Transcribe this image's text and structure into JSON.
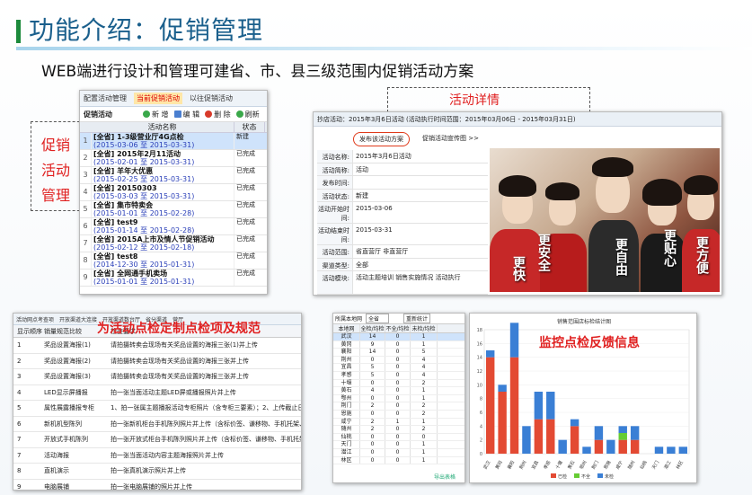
{
  "header": {
    "title": "功能介绍：促销管理",
    "subtitle": "WEB端进行设计和管理可建省、市、县三级范围内促销活动方案"
  },
  "labels": {
    "left": "促销活动管理",
    "detail": "活动详情",
    "checkpoint": "为活动点检定制点检项及规范",
    "feedback": "监控点检反馈信息"
  },
  "promo": {
    "tabs": [
      "配置活动管理",
      "当前促销活动",
      "以往促销活动"
    ],
    "toolbar": {
      "title": "促销活动",
      "new": "新 增",
      "edit": "编 辑",
      "delete": "删 除",
      "refresh": "刷新"
    },
    "columns": {
      "name": "活动名称",
      "status": "状态"
    },
    "rows": [
      {
        "n": "1",
        "name": "[全省] 1-3级营业厅4G点检",
        "date": "(2015-03-06 至 2015-03-31)",
        "status": "新建"
      },
      {
        "n": "2",
        "name": "[全省] 2015年2月11活动",
        "date": "(2015-02-01 至 2015-03-31)",
        "status": "已完成"
      },
      {
        "n": "3",
        "name": "[全省] 羊年大优惠",
        "date": "(2015-02-25 至 2015-03-31)",
        "status": "已完成"
      },
      {
        "n": "4",
        "name": "[全省] 20150303",
        "date": "(2015-03-03 至 2015-03-31)",
        "status": "已完成"
      },
      {
        "n": "5",
        "name": "[全省] 集市特卖会",
        "date": "(2015-01-01 至 2015-02-28)",
        "status": "已完成"
      },
      {
        "n": "6",
        "name": "[全省] test9",
        "date": "(2015-01-14 至 2015-02-28)",
        "status": "已完成"
      },
      {
        "n": "7",
        "name": "[全省] 2015A上市及情人节促销活动",
        "date": "(2015-02-12 至 2015-02-18)",
        "status": "已完成"
      },
      {
        "n": "8",
        "name": "[全省] test8",
        "date": "(2014-12-30 至 2015-01-31)",
        "status": "已完成"
      },
      {
        "n": "9",
        "name": "[全省] 全网通手机卖场",
        "date": "(2015-01-01 至 2015-01-31)",
        "status": "已完成"
      }
    ]
  },
  "detail": {
    "head": "抄店活动：2015年3月6日活动 (活动执行时间范围：2015年03月06日 - 2015年03月31日)",
    "btn_publish": "发布该活动方案",
    "btn_img": "促销活动宣传图 >>",
    "fields": [
      {
        "k": "活动名称:",
        "v": "2015年3月6日活动"
      },
      {
        "k": "活动简称:",
        "v": "活动"
      },
      {
        "k": "发布时间:",
        "v": ""
      },
      {
        "k": "活动状态:",
        "v": "新建"
      },
      {
        "k": "活动开始时间:",
        "v": "2015-03-06"
      },
      {
        "k": "活动结束时间:",
        "v": "2015-03-31"
      },
      {
        "k": "活动范围:",
        "v": "省直营厅 非直营厅"
      },
      {
        "k": "渠道类型:",
        "v": "全部"
      },
      {
        "k": "活动模块:",
        "v": "活动主题培训 销售实施情况 活动执行"
      },
      {
        "k": "活动描述:",
        "v": ""
      }
    ],
    "slogans": [
      "更安全",
      "更快",
      "更自由",
      "更贴心",
      "更方便"
    ]
  },
  "checklist": {
    "tabs": [
      "活动网点考查项",
      "开放渠道大连接",
      "开放渠道数台厅",
      "省分渠道",
      "营厅"
    ],
    "columns": {
      "seq": "显示顺序",
      "item": "销量规范比较",
      "req": "检查要求"
    },
    "rows": [
      {
        "seq": "1",
        "item": "奖品设置海报(1)",
        "req": "请拍摄转卖会现场有关奖品设置的海报三张(1)并上传"
      },
      {
        "seq": "2",
        "item": "奖品设置海报(2)",
        "req": "请拍摄转卖会现场有关奖品设置的海报三张并上传"
      },
      {
        "seq": "3",
        "item": "奖品设置海报(3)",
        "req": "请拍摄转卖会现场有关奖品设置的海报三张并上传"
      },
      {
        "seq": "4",
        "item": "LED显示屏播报",
        "req": "拍一张当面活动主题LED屏或播报照片并上传"
      },
      {
        "seq": "5",
        "item": "属性展露播报专柜",
        "req": "1、拍一张属主题播报活动专柜照片（含专柜三要素）；2、上传截止日期为3月30日24点"
      },
      {
        "seq": "6",
        "item": "新机机型陈列",
        "req": "拍一张新机柜台手机陈列照片并上传（含标价签、谦移物、手机托架、绑卡挂件）"
      },
      {
        "seq": "7",
        "item": "开放式手机陈列",
        "req": "拍一张开放式柜台手机陈列照片并上传（含标价签、谦移物、手机托架、功能台卡、宣传单页）"
      },
      {
        "seq": "7",
        "item": "活动海报",
        "req": "拍一张当面活动内容主题海报照片并上传"
      },
      {
        "seq": "8",
        "item": "直机演示",
        "req": "拍一张真机演示照片并上传"
      },
      {
        "seq": "9",
        "item": "电脑展铺",
        "req": "拍一张电脑展铺的照片并上传"
      },
      {
        "seq": "10",
        "item": "礼品堆头",
        "req": "拍一张礼品堆头的照片并上传"
      }
    ]
  },
  "region": {
    "select": "全省",
    "btn": "重新统计",
    "top": "所属本地网",
    "columns": [
      "本地网",
      "全检/均检",
      "不全/均检",
      "未检/均检"
    ],
    "rows": [
      [
        "武汉",
        "14",
        "0",
        "1"
      ],
      [
        "黄冈",
        "9",
        "0",
        "1"
      ],
      [
        "襄阳",
        "14",
        "0",
        "5"
      ],
      [
        "荆州",
        "0",
        "0",
        "4"
      ],
      [
        "宜昌",
        "5",
        "0",
        "4"
      ],
      [
        "孝感",
        "5",
        "0",
        "4"
      ],
      [
        "十堰",
        "0",
        "0",
        "2"
      ],
      [
        "黄石",
        "4",
        "0",
        "1"
      ],
      [
        "鄂州",
        "0",
        "0",
        "1"
      ],
      [
        "荆门",
        "2",
        "0",
        "2"
      ],
      [
        "恩施",
        "0",
        "0",
        "2"
      ],
      [
        "咸宁",
        "2",
        "1",
        "1"
      ],
      [
        "随州",
        "2",
        "0",
        "2"
      ],
      [
        "仙桃",
        "0",
        "0",
        "0"
      ],
      [
        "天门",
        "0",
        "0",
        "1"
      ],
      [
        "潜江",
        "0",
        "0",
        "1"
      ],
      [
        "林区",
        "0",
        "0",
        "1"
      ]
    ],
    "foot": "导出表格"
  },
  "chart_data": {
    "type": "bar",
    "title": "销售范围店标检结计图",
    "categories": [
      "武汉",
      "黄冈",
      "襄阳",
      "荆州",
      "宜昌",
      "孝感",
      "十堰",
      "黄石",
      "鄂州",
      "荆门",
      "恩施",
      "咸宁",
      "随州",
      "仙桃",
      "天门",
      "潜江",
      "林区"
    ],
    "series": [
      {
        "name": "已检",
        "values": [
          14,
          9,
          14,
          0,
          5,
          5,
          0,
          4,
          0,
          2,
          0,
          2,
          2,
          0,
          0,
          0,
          0
        ],
        "color": "#e34a33"
      },
      {
        "name": "不全",
        "values": [
          0,
          0,
          0,
          0,
          0,
          0,
          0,
          0,
          0,
          0,
          0,
          1,
          0,
          0,
          0,
          0,
          0
        ],
        "color": "#66cc33"
      },
      {
        "name": "未检",
        "values": [
          1,
          1,
          5,
          4,
          4,
          4,
          2,
          1,
          1,
          2,
          2,
          1,
          2,
          0,
          1,
          1,
          1
        ],
        "color": "#3a7fd5"
      }
    ],
    "ylim": [
      0,
      18
    ],
    "stacked": true,
    "legend": "bottom"
  }
}
